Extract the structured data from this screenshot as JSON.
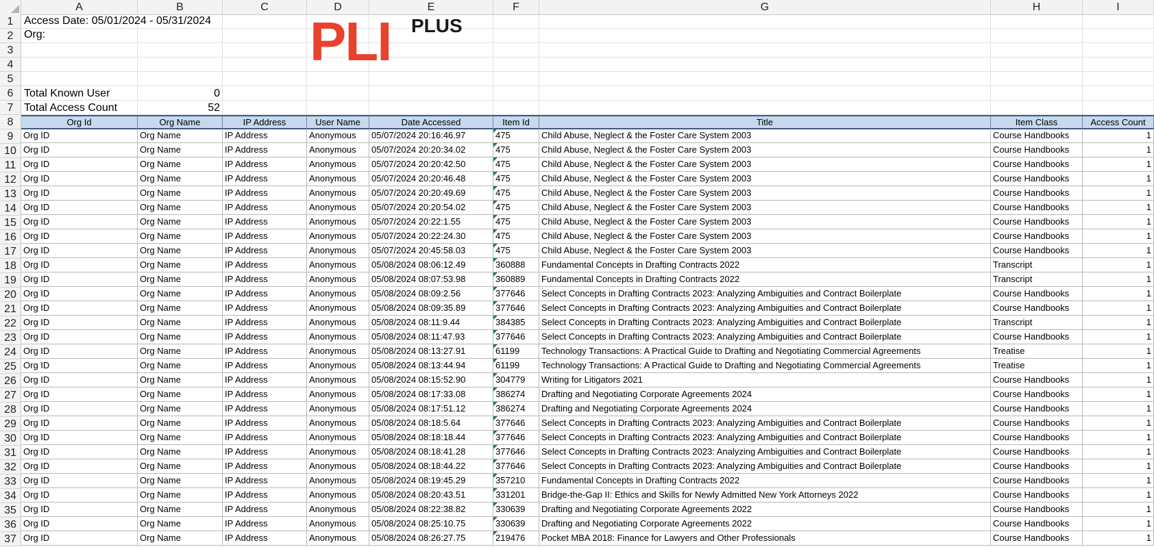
{
  "column_letters": [
    "A",
    "B",
    "C",
    "D",
    "E",
    "F",
    "G",
    "H",
    "I"
  ],
  "row_numbers": [
    "1",
    "2",
    "3",
    "4",
    "5",
    "6",
    "7",
    "8",
    "9",
    "10",
    "11",
    "12",
    "13",
    "14",
    "15",
    "16",
    "17",
    "18",
    "19",
    "20",
    "21",
    "22",
    "23",
    "24",
    "25",
    "26",
    "27",
    "28",
    "29",
    "30",
    "31",
    "32",
    "33",
    "34",
    "35",
    "36",
    "37"
  ],
  "header_block": {
    "access_date_label": "Access Date:  05/01/2024 - 05/31/2024",
    "org_label": "Org:",
    "total_known_user_label": "Total Known User",
    "total_known_user_value": "0",
    "total_access_count_label": "Total Access Count",
    "total_access_count_value": "52"
  },
  "logo": {
    "main": "PLI",
    "suffix": "PLUS"
  },
  "colors": {
    "logo_red": "#e8412c",
    "header_fill": "#c6d9ee",
    "header_border": "#3d5a80",
    "number_flag": "#1e7e34"
  },
  "table": {
    "columns": [
      "Org Id",
      "Org Name",
      "IP Address",
      "User Name",
      "Date Accessed",
      "Item Id",
      "Title",
      "Item Class",
      "Access Count"
    ],
    "rows": [
      [
        "Org ID",
        "Org Name",
        "IP Address",
        "Anonymous",
        "05/07/2024 20:16:46.97",
        "475",
        "Child Abuse, Neglect & the Foster Care System 2003",
        "Course Handbooks",
        "1"
      ],
      [
        "Org ID",
        "Org Name",
        "IP Address",
        "Anonymous",
        "05/07/2024 20:20:34.02",
        "475",
        "Child Abuse, Neglect & the Foster Care System 2003",
        "Course Handbooks",
        "1"
      ],
      [
        "Org ID",
        "Org Name",
        "IP Address",
        "Anonymous",
        "05/07/2024 20:20:42.50",
        "475",
        "Child Abuse, Neglect & the Foster Care System 2003",
        "Course Handbooks",
        "1"
      ],
      [
        "Org ID",
        "Org Name",
        "IP Address",
        "Anonymous",
        "05/07/2024 20:20:46.48",
        "475",
        "Child Abuse, Neglect & the Foster Care System 2003",
        "Course Handbooks",
        "1"
      ],
      [
        "Org ID",
        "Org Name",
        "IP Address",
        "Anonymous",
        "05/07/2024 20:20:49.69",
        "475",
        "Child Abuse, Neglect & the Foster Care System 2003",
        "Course Handbooks",
        "1"
      ],
      [
        "Org ID",
        "Org Name",
        "IP Address",
        "Anonymous",
        "05/07/2024 20:20:54.02",
        "475",
        "Child Abuse, Neglect & the Foster Care System 2003",
        "Course Handbooks",
        "1"
      ],
      [
        "Org ID",
        "Org Name",
        "IP Address",
        "Anonymous",
        "05/07/2024 20:22:1.55",
        "475",
        "Child Abuse, Neglect & the Foster Care System 2003",
        "Course Handbooks",
        "1"
      ],
      [
        "Org ID",
        "Org Name",
        "IP Address",
        "Anonymous",
        "05/07/2024 20:22:24.30",
        "475",
        "Child Abuse, Neglect & the Foster Care System 2003",
        "Course Handbooks",
        "1"
      ],
      [
        "Org ID",
        "Org Name",
        "IP Address",
        "Anonymous",
        "05/07/2024 20:45:58.03",
        "475",
        "Child Abuse, Neglect & the Foster Care System 2003",
        "Course Handbooks",
        "1"
      ],
      [
        "Org ID",
        "Org Name",
        "IP Address",
        "Anonymous",
        "05/08/2024 08:06:12.49",
        "360888",
        "Fundamental Concepts in Drafting Contracts 2022",
        "Transcript",
        "1"
      ],
      [
        "Org ID",
        "Org Name",
        "IP Address",
        "Anonymous",
        "05/08/2024 08:07:53.98",
        "360889",
        "Fundamental Concepts in Drafting Contracts 2022",
        "Transcript",
        "1"
      ],
      [
        "Org ID",
        "Org Name",
        "IP Address",
        "Anonymous",
        "05/08/2024 08:09:2.56",
        "377646",
        "Select Concepts in Drafting Contracts 2023: Analyzing Ambiguities and Contract Boilerplate",
        "Course Handbooks",
        "1"
      ],
      [
        "Org ID",
        "Org Name",
        "IP Address",
        "Anonymous",
        "05/08/2024 08:09:35.89",
        "377646",
        "Select Concepts in Drafting Contracts 2023: Analyzing Ambiguities and Contract Boilerplate",
        "Course Handbooks",
        "1"
      ],
      [
        "Org ID",
        "Org Name",
        "IP Address",
        "Anonymous",
        "05/08/2024 08:11:9.44",
        "384385",
        "Select Concepts in Drafting Contracts 2023: Analyzing Ambiguities and Contract Boilerplate",
        "Transcript",
        "1"
      ],
      [
        "Org ID",
        "Org Name",
        "IP Address",
        "Anonymous",
        "05/08/2024 08:11:47.93",
        "377646",
        "Select Concepts in Drafting Contracts 2023: Analyzing Ambiguities and Contract Boilerplate",
        "Course Handbooks",
        "1"
      ],
      [
        "Org ID",
        "Org Name",
        "IP Address",
        "Anonymous",
        "05/08/2024 08:13:27.91",
        "61199",
        "Technology Transactions: A Practical Guide to Drafting and Negotiating Commercial Agreements",
        "Treatise",
        "1"
      ],
      [
        "Org ID",
        "Org Name",
        "IP Address",
        "Anonymous",
        "05/08/2024 08:13:44.94",
        "61199",
        "Technology Transactions: A Practical Guide to Drafting and Negotiating Commercial Agreements",
        "Treatise",
        "1"
      ],
      [
        "Org ID",
        "Org Name",
        "IP Address",
        "Anonymous",
        "05/08/2024 08:15:52.90",
        "304779",
        "Writing for Litigators 2021",
        "Course Handbooks",
        "1"
      ],
      [
        "Org ID",
        "Org Name",
        "IP Address",
        "Anonymous",
        "05/08/2024 08:17:33.08",
        "386274",
        "Drafting and Negotiating Corporate Agreements 2024",
        "Course Handbooks",
        "1"
      ],
      [
        "Org ID",
        "Org Name",
        "IP Address",
        "Anonymous",
        "05/08/2024 08:17:51.12",
        "386274",
        "Drafting and Negotiating Corporate Agreements 2024",
        "Course Handbooks",
        "1"
      ],
      [
        "Org ID",
        "Org Name",
        "IP Address",
        "Anonymous",
        "05/08/2024 08:18:5.64",
        "377646",
        "Select Concepts in Drafting Contracts 2023: Analyzing Ambiguities and Contract Boilerplate",
        "Course Handbooks",
        "1"
      ],
      [
        "Org ID",
        "Org Name",
        "IP Address",
        "Anonymous",
        "05/08/2024 08:18:18.44",
        "377646",
        "Select Concepts in Drafting Contracts 2023: Analyzing Ambiguities and Contract Boilerplate",
        "Course Handbooks",
        "1"
      ],
      [
        "Org ID",
        "Org Name",
        "IP Address",
        "Anonymous",
        "05/08/2024 08:18:41.28",
        "377646",
        "Select Concepts in Drafting Contracts 2023: Analyzing Ambiguities and Contract Boilerplate",
        "Course Handbooks",
        "1"
      ],
      [
        "Org ID",
        "Org Name",
        "IP Address",
        "Anonymous",
        "05/08/2024 08:18:44.22",
        "377646",
        "Select Concepts in Drafting Contracts 2023: Analyzing Ambiguities and Contract Boilerplate",
        "Course Handbooks",
        "1"
      ],
      [
        "Org ID",
        "Org Name",
        "IP Address",
        "Anonymous",
        "05/08/2024 08:19:45.29",
        "357210",
        "Fundamental Concepts in Drafting Contracts 2022",
        "Course Handbooks",
        "1"
      ],
      [
        "Org ID",
        "Org Name",
        "IP Address",
        "Anonymous",
        "05/08/2024 08:20:43.51",
        "331201",
        "Bridge-the-Gap II: Ethics and Skills for Newly Admitted New York Attorneys 2022",
        "Course Handbooks",
        "1"
      ],
      [
        "Org ID",
        "Org Name",
        "IP Address",
        "Anonymous",
        "05/08/2024 08:22:38.82",
        "330639",
        "Drafting and Negotiating Corporate Agreements 2022",
        "Course Handbooks",
        "1"
      ],
      [
        "Org ID",
        "Org Name",
        "IP Address",
        "Anonymous",
        "05/08/2024 08:25:10.75",
        "330639",
        "Drafting and Negotiating Corporate Agreements 2022",
        "Course Handbooks",
        "1"
      ],
      [
        "Org ID",
        "Org Name",
        "IP Address",
        "Anonymous",
        "05/08/2024 08:26:27.75",
        "219476",
        "Pocket MBA 2018: Finance for Lawyers and Other Professionals",
        "Course Handbooks",
        "1"
      ]
    ]
  }
}
